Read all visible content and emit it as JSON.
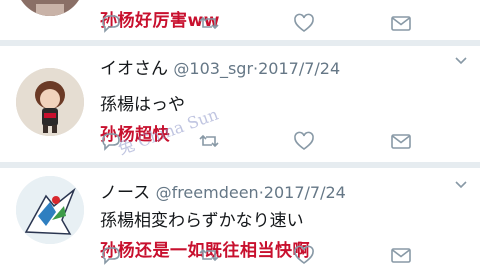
{
  "tweets": [
    {
      "subtitle": "孙杨好厉害ww"
    },
    {
      "name": "イオさん",
      "handle": "@103_sgr",
      "date": "2017/7/24",
      "dot": "·",
      "text": "孫楊はっや",
      "subtitle": "孙杨超快"
    },
    {
      "name": "ノース",
      "handle": "@freemdeen",
      "date": "2017/7/24",
      "dot": "·",
      "text": "孫楊相変わらずかなり速い",
      "subtitle": "孙杨还是一如既往相当快啊"
    }
  ],
  "watermark": "兔 China Sun",
  "colors": {
    "accent": "#c8102e",
    "icon": "#8899a6",
    "text": "#14171a",
    "muted": "#657786"
  },
  "icons": [
    "reply-icon",
    "retweet-icon",
    "like-icon",
    "message-icon",
    "chevron-down-icon"
  ]
}
